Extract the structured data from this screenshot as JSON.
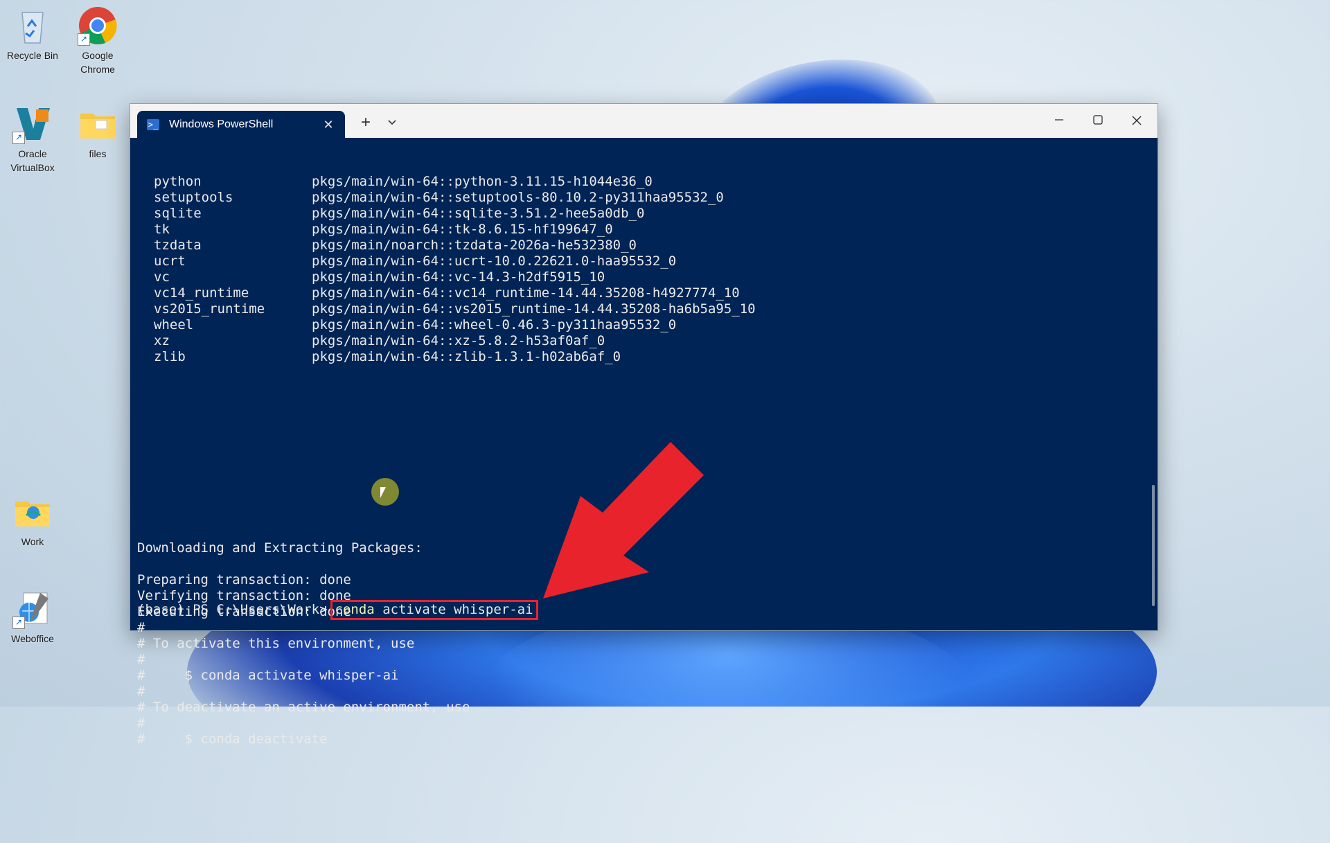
{
  "desktop": {
    "icons": [
      {
        "label": "Recycle Bin",
        "icon": "recycle-bin-icon"
      },
      {
        "label": "Google Chrome",
        "icon": "chrome-icon"
      },
      {
        "label": "Oracle VirtualBox",
        "icon": "virtualbox-icon"
      },
      {
        "label": "files",
        "icon": "folder-icon"
      },
      {
        "label": "Work",
        "icon": "folder-icon"
      },
      {
        "label": "Weboffice",
        "icon": "weboffice-icon"
      }
    ]
  },
  "window": {
    "tab_title": "Windows PowerShell",
    "new_tab": "+",
    "dropdown": "⌄",
    "minimize": "—",
    "maximize": "☐",
    "close": "✕",
    "tab_close": "✕"
  },
  "terminal": {
    "packages": [
      {
        "name": "python",
        "spec": "pkgs/main/win-64::python-3.11.15-h1044e36_0"
      },
      {
        "name": "setuptools",
        "spec": "pkgs/main/win-64::setuptools-80.10.2-py311haa95532_0"
      },
      {
        "name": "sqlite",
        "spec": "pkgs/main/win-64::sqlite-3.51.2-hee5a0db_0"
      },
      {
        "name": "tk",
        "spec": "pkgs/main/win-64::tk-8.6.15-hf199647_0"
      },
      {
        "name": "tzdata",
        "spec": "pkgs/main/noarch::tzdata-2026a-he532380_0"
      },
      {
        "name": "ucrt",
        "spec": "pkgs/main/win-64::ucrt-10.0.22621.0-haa95532_0"
      },
      {
        "name": "vc",
        "spec": "pkgs/main/win-64::vc-14.3-h2df5915_10"
      },
      {
        "name": "vc14_runtime",
        "spec": "pkgs/main/win-64::vc14_runtime-14.44.35208-h4927774_10"
      },
      {
        "name": "vs2015_runtime",
        "spec": "pkgs/main/win-64::vs2015_runtime-14.44.35208-ha6b5a95_10"
      },
      {
        "name": "wheel",
        "spec": "pkgs/main/win-64::wheel-0.46.3-py311haa95532_0"
      },
      {
        "name": "xz",
        "spec": "pkgs/main/win-64::xz-5.8.2-h53af0af_0"
      },
      {
        "name": "zlib",
        "spec": "pkgs/main/win-64::zlib-1.3.1-h02ab6af_0"
      }
    ],
    "lines": [
      "Downloading and Extracting Packages:",
      "",
      "Preparing transaction: done",
      "Verifying transaction: done",
      "Executing transaction: done",
      "#",
      "# To activate this environment, use",
      "#",
      "#     $ conda activate whisper-ai",
      "#",
      "# To deactivate an active environment, use",
      "#",
      "#     $ conda deactivate"
    ],
    "prompt": "(base) PS C:\\Users\\Work>",
    "command_keyword": "conda",
    "command_rest": " activate whisper-ai"
  },
  "colors": {
    "terminal_bg": "#012456",
    "highlight_box": "#e8232c",
    "arrow": "#e8232c"
  }
}
